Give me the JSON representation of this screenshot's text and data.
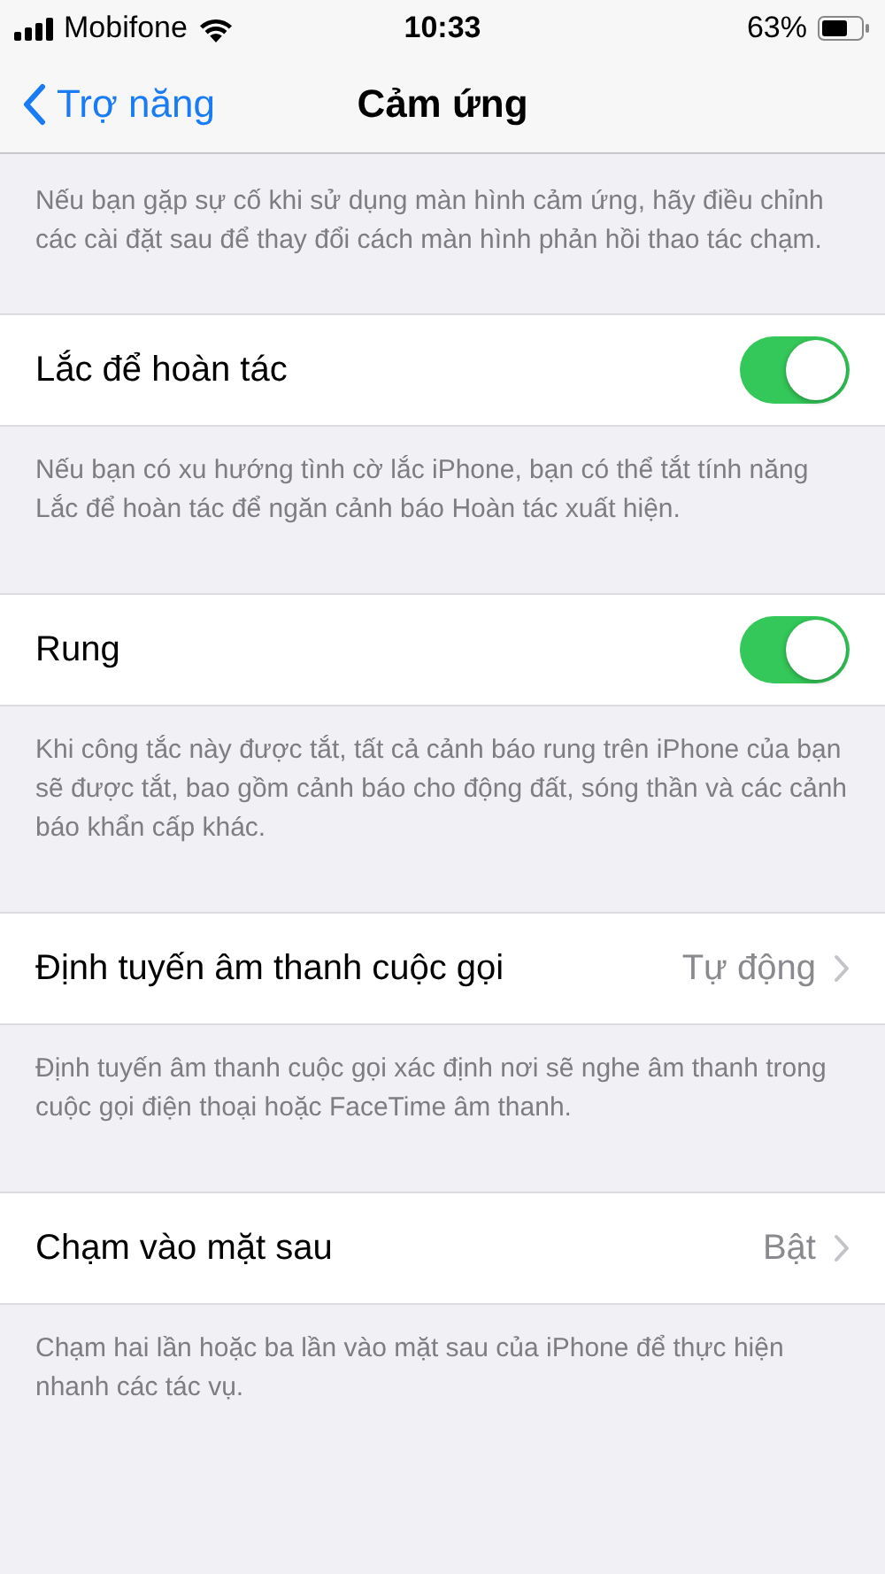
{
  "status_bar": {
    "carrier": "Mobifone",
    "time": "10:33",
    "battery": "63%"
  },
  "nav": {
    "back": "Trợ năng",
    "title": "Cảm ứng"
  },
  "intro": "Nếu bạn gặp sự cố khi sử dụng màn hình cảm ứng, hãy điều chỉnh các cài đặt sau để thay đổi cách màn hình phản hồi thao tác chạm.",
  "rows": [
    {
      "kind": "toggle",
      "label": "Lắc để hoàn tác",
      "on": true,
      "footer": "Nếu bạn có xu hướng tình cờ lắc iPhone, bạn có thể tắt tính năng Lắc để hoàn tác để ngăn cảnh báo Hoàn tác xuất hiện."
    },
    {
      "kind": "toggle",
      "label": "Rung",
      "on": true,
      "footer": "Khi công tắc này được tắt, tất cả cảnh báo rung trên iPhone của bạn sẽ được tắt, bao gồm cảnh báo cho động đất, sóng thần và các cảnh báo khẩn cấp khác."
    },
    {
      "kind": "link",
      "label": "Định tuyến âm thanh cuộc gọi",
      "value": "Tự động",
      "footer": "Định tuyến âm thanh cuộc gọi xác định nơi sẽ nghe âm thanh trong cuộc gọi điện thoại hoặc FaceTime âm thanh."
    },
    {
      "kind": "link",
      "label": "Chạm vào mặt sau",
      "value": "Bật",
      "footer": "Chạm hai lần hoặc ba lần vào mặt sau của iPhone để thực hiện nhanh các tác vụ."
    }
  ]
}
